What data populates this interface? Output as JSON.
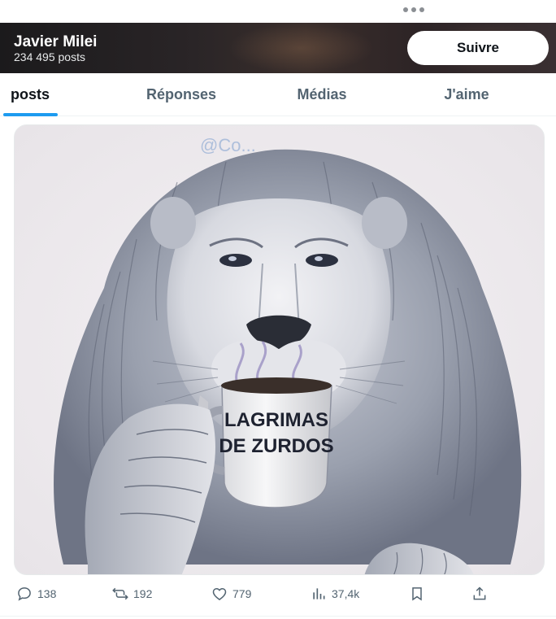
{
  "profile": {
    "name": "Javier Milei",
    "post_count": "234 495 posts",
    "follow_label": "Suivre"
  },
  "tabs": [
    {
      "label": "posts",
      "active": true
    },
    {
      "label": "Réponses",
      "active": false
    },
    {
      "label": "Médias",
      "active": false
    },
    {
      "label": "J'aime",
      "active": false
    }
  ],
  "media": {
    "watermark": "@Co...",
    "mug_text_line1": "LAGRIMAS",
    "mug_text_line2": "DE ZURDOS"
  },
  "actions": {
    "replies": "138",
    "reposts": "192",
    "likes": "779",
    "views": "37,4k"
  },
  "colors": {
    "accent": "#1d9bf0",
    "muted": "#536471",
    "text": "#0f1419"
  },
  "icons": [
    "more-dots-icon",
    "reply-icon",
    "repost-icon",
    "like-icon",
    "views-icon",
    "bookmark-icon",
    "share-icon"
  ]
}
